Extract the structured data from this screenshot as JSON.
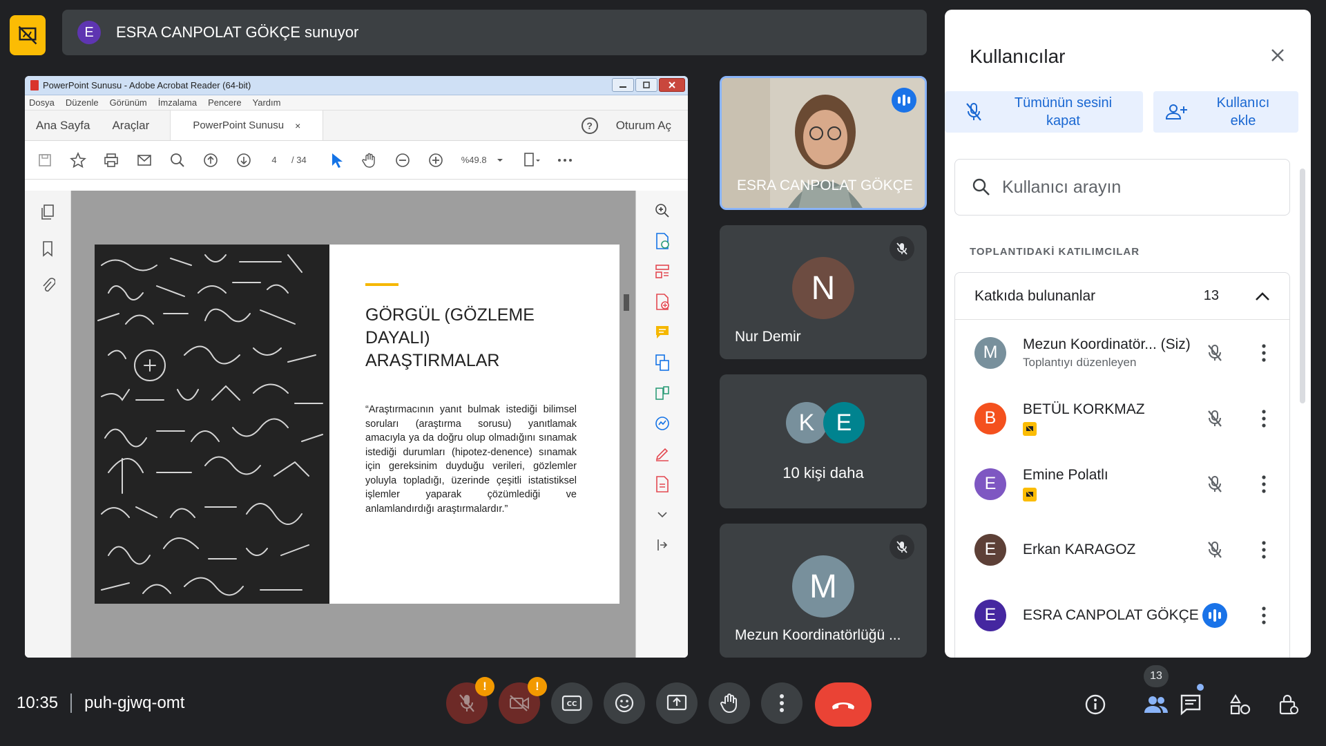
{
  "presenter_bar": {
    "avatar_letter": "E",
    "text": "ESRA CANPOLAT GÖKÇE sunuyor"
  },
  "acrobat": {
    "window_title": "PowerPoint Sunusu - Adobe Acrobat Reader (64-bit)",
    "menu": [
      "Dosya",
      "Düzenle",
      "Görünüm",
      "İmzalama",
      "Pencere",
      "Yardım"
    ],
    "tabs": {
      "home": "Ana Sayfa",
      "tools": "Araçlar",
      "document": "PowerPoint Sunusu",
      "close_glyph": "×"
    },
    "sign_in": "Oturum Aç",
    "page_current": "4",
    "page_total": "/ 34",
    "zoom": "%49.8",
    "slide": {
      "title_line1": "GÖRGÜL (GÖZLEME DAYALI)",
      "title_line2": "ARAŞTIRMALAR",
      "body": "“Araştırmacının yanıt bulmak istediği bilimsel soruları (araştırma sorusu) yanıtlamak amacıyla ya da doğru olup olmadığını sınamak istediği durumları (hipotez-denence) sınamak için gereksinim duyduğu verileri, gözlemler yoluyla topladığı, üzerinde çeşitli istatistiksel işlemler yaparak çözümlediği ve anlamlandırdığı araştırmalardır.”"
    }
  },
  "tiles": {
    "presenter": {
      "name": "ESRA CANPOLAT GÖKÇE"
    },
    "nur": {
      "letter": "N",
      "name": "Nur Demir",
      "color": "#6d4c41"
    },
    "more": {
      "letter1": "K",
      "letter2": "E",
      "label": "10 kişi daha"
    },
    "mezun": {
      "letter": "M",
      "name": "Mezun Koordinatörlüğü ...",
      "color": "#78909c"
    }
  },
  "panel": {
    "title": "Kullanıcılar",
    "mute_all_line1": "Tümünün sesini",
    "mute_all_line2": "kapat",
    "add_user_line1": "Kullanıcı",
    "add_user_line2": "ekle",
    "search_placeholder": "Kullanıcı arayın",
    "section_label": "TOPLANTIDAKİ KATILIMCILAR",
    "contributors_label": "Katkıda bulunanlar",
    "contributors_count": "13",
    "participants": [
      {
        "letter": "M",
        "name": "Mezun Koordinatör... (Siz)",
        "sub": "Toplantıyı düzenleyen",
        "color": "#78909c"
      },
      {
        "letter": "B",
        "name": "BETÜL KORKMAZ",
        "color": "#f4511e"
      },
      {
        "letter": "E",
        "name": "Emine Polatlı",
        "color": "#7e57c2"
      },
      {
        "letter": "E",
        "name": "Erkan KARAGOZ",
        "color": "#5d4037"
      },
      {
        "letter": "E",
        "name": "ESRA CANPOLAT GÖKÇE",
        "color": "#4527a0"
      }
    ]
  },
  "bottom": {
    "time": "10:35",
    "meeting_code": "puh-gjwq-omt",
    "people_count": "13",
    "warning_glyph": "!"
  },
  "colors": {
    "accent": "#fbbc04",
    "leave": "#ea4335",
    "active_border": "#8ab4f8",
    "panel_button": "#e8f0fe"
  }
}
